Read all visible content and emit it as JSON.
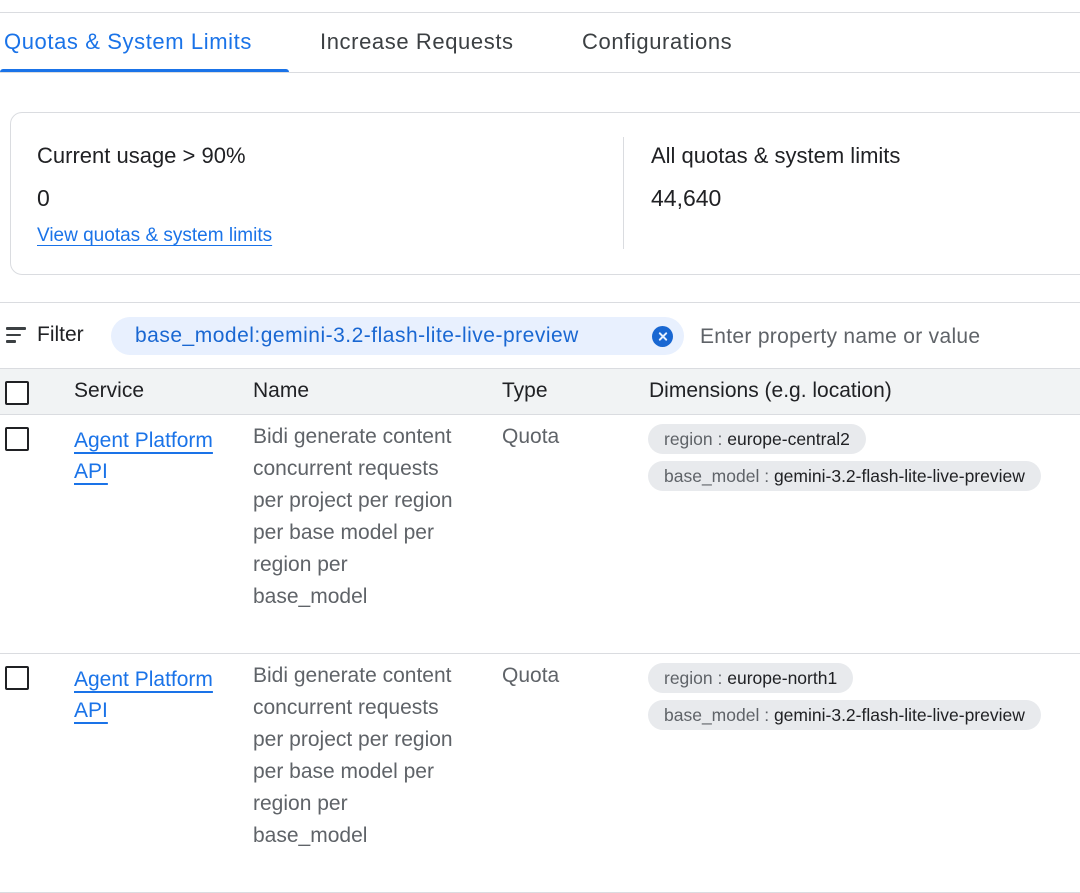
{
  "tabs": [
    {
      "label": "Quotas & System Limits",
      "active": true
    },
    {
      "label": "Increase Requests",
      "active": false
    },
    {
      "label": "Configurations",
      "active": false
    }
  ],
  "summary": {
    "usage": {
      "label": "Current usage > 90%",
      "value": "0",
      "link": "View quotas & system limits"
    },
    "all": {
      "label": "All quotas & system limits",
      "value": "44,640"
    }
  },
  "filter": {
    "label": "Filter",
    "chip": "base_model:gemini-3.2-flash-lite-live-preview",
    "placeholder": "Enter property name or value"
  },
  "table": {
    "columns": [
      "Service",
      "Name",
      "Type",
      "Dimensions (e.g. location)"
    ],
    "rows": [
      {
        "service": "Agent Platform API",
        "name": "Bidi generate content concurrent requests per project per region per base model per region per base_model",
        "type": "Quota",
        "dimensions": [
          {
            "key": "region",
            "value": "europe-central2"
          },
          {
            "key": "base_model",
            "value": "gemini-3.2-flash-lite-live-preview"
          }
        ]
      },
      {
        "service": "Agent Platform API",
        "name": "Bidi generate content concurrent requests per project per region per base model per region per base_model",
        "type": "Quota",
        "dimensions": [
          {
            "key": "region",
            "value": "europe-north1"
          },
          {
            "key": "base_model",
            "value": "gemini-3.2-flash-lite-live-preview"
          }
        ]
      }
    ]
  },
  "colors": {
    "accent": "#1a73e8",
    "chip_bg": "#e8f0fe",
    "header_bg": "#f1f3f4",
    "dim_chip_bg": "#e8eaed"
  },
  "icons": {
    "filter": "filter-lines-icon",
    "chip_remove": "close-circle-icon"
  }
}
